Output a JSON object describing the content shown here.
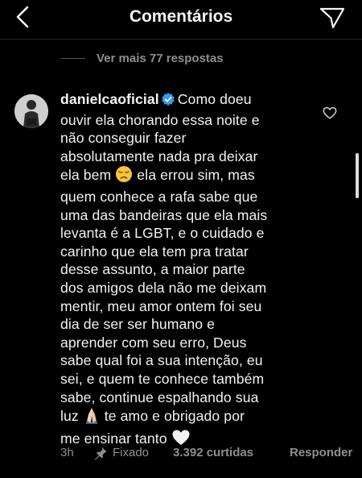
{
  "header": {
    "title": "Comentários",
    "back_icon": "chevron-left-icon",
    "send_icon": "paper-plane-icon"
  },
  "thread": {
    "more_replies": "Ver mais 77 respostas"
  },
  "comment": {
    "username": "danielcaoficial",
    "verified": true,
    "lines": [
      "Como doeu",
      "ouvir ela chorando essa noite e",
      "não conseguir fazer",
      "absolutamente nada pra deixar",
      "ela bem",
      "ela errou sim, mas",
      "quem conhece a rafa sabe que",
      "uma das bandeiras que ela mais",
      "levanta é a LGBT, e o cuidado e",
      "carinho que ela tem pra tratar",
      "desse assunto, a maior parte",
      "dos amigos dela não me deixam",
      "mentir, meu amor ontem foi seu",
      "dia de ser ser humano e",
      "aprender com seu erro, Deus",
      "sabe qual foi a sua intenção, eu",
      "sei, e quem te conhece também",
      "sabe, continue espalhando sua",
      "luz",
      "te amo e obrigado por",
      "me ensinar tanto"
    ],
    "emojis": {
      "sad": "disappointed-face-emoji",
      "pray": "folded-hands-emoji",
      "heart": "white-heart-emoji"
    }
  },
  "footer": {
    "time": "3h",
    "pinned_label": "Fixado",
    "likes": "3.392 curtidas",
    "reply": "Responder"
  },
  "colors": {
    "background": "#000000",
    "text": "#f5f5f5",
    "muted": "#8e8e8e",
    "verified": "#3897f0"
  }
}
